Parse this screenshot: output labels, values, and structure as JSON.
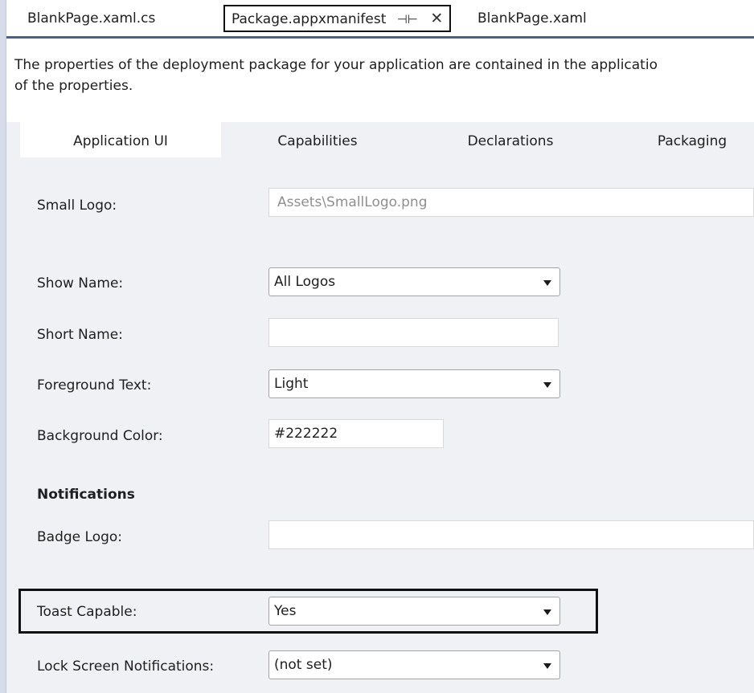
{
  "document_tabs": [
    {
      "label": "BlankPage.xaml.cs"
    },
    {
      "label": "Package.appxmanifest",
      "pin_glyph": "⊣⊢",
      "close_glyph": "✕",
      "active": true
    },
    {
      "label": "BlankPage.xaml"
    }
  ],
  "description": {
    "line1": "The properties of the deployment package for your application are contained in the applicatio",
    "line2": "of the properties."
  },
  "property_tabs": [
    {
      "label": "Application UI",
      "active": true
    },
    {
      "label": "Capabilities"
    },
    {
      "label": "Declarations"
    },
    {
      "label": "Packaging"
    }
  ],
  "form": {
    "small_logo": {
      "label": "Small Logo:",
      "value": "Assets\\SmallLogo.png"
    },
    "show_name": {
      "label": "Show Name:",
      "value": "All Logos"
    },
    "short_name": {
      "label": "Short Name:",
      "value": ""
    },
    "foreground_text": {
      "label": "Foreground Text:",
      "value": "Light"
    },
    "background_color": {
      "label": "Background Color:",
      "value": "#222222"
    },
    "notifications_heading": "Notifications",
    "badge_logo": {
      "label": "Badge Logo:",
      "value": ""
    },
    "toast_capable": {
      "label": "Toast Capable:",
      "value": "Yes"
    },
    "lock_screen_notifications": {
      "label": "Lock Screen Notifications:",
      "value": "(not set)"
    }
  },
  "colors": {
    "tab_underline": "#4a6184",
    "panel_background": "#f0f1f4",
    "highlight_border": "#111111"
  },
  "icons": [
    "pin-icon",
    "close-icon",
    "dropdown-arrow-icon"
  ]
}
